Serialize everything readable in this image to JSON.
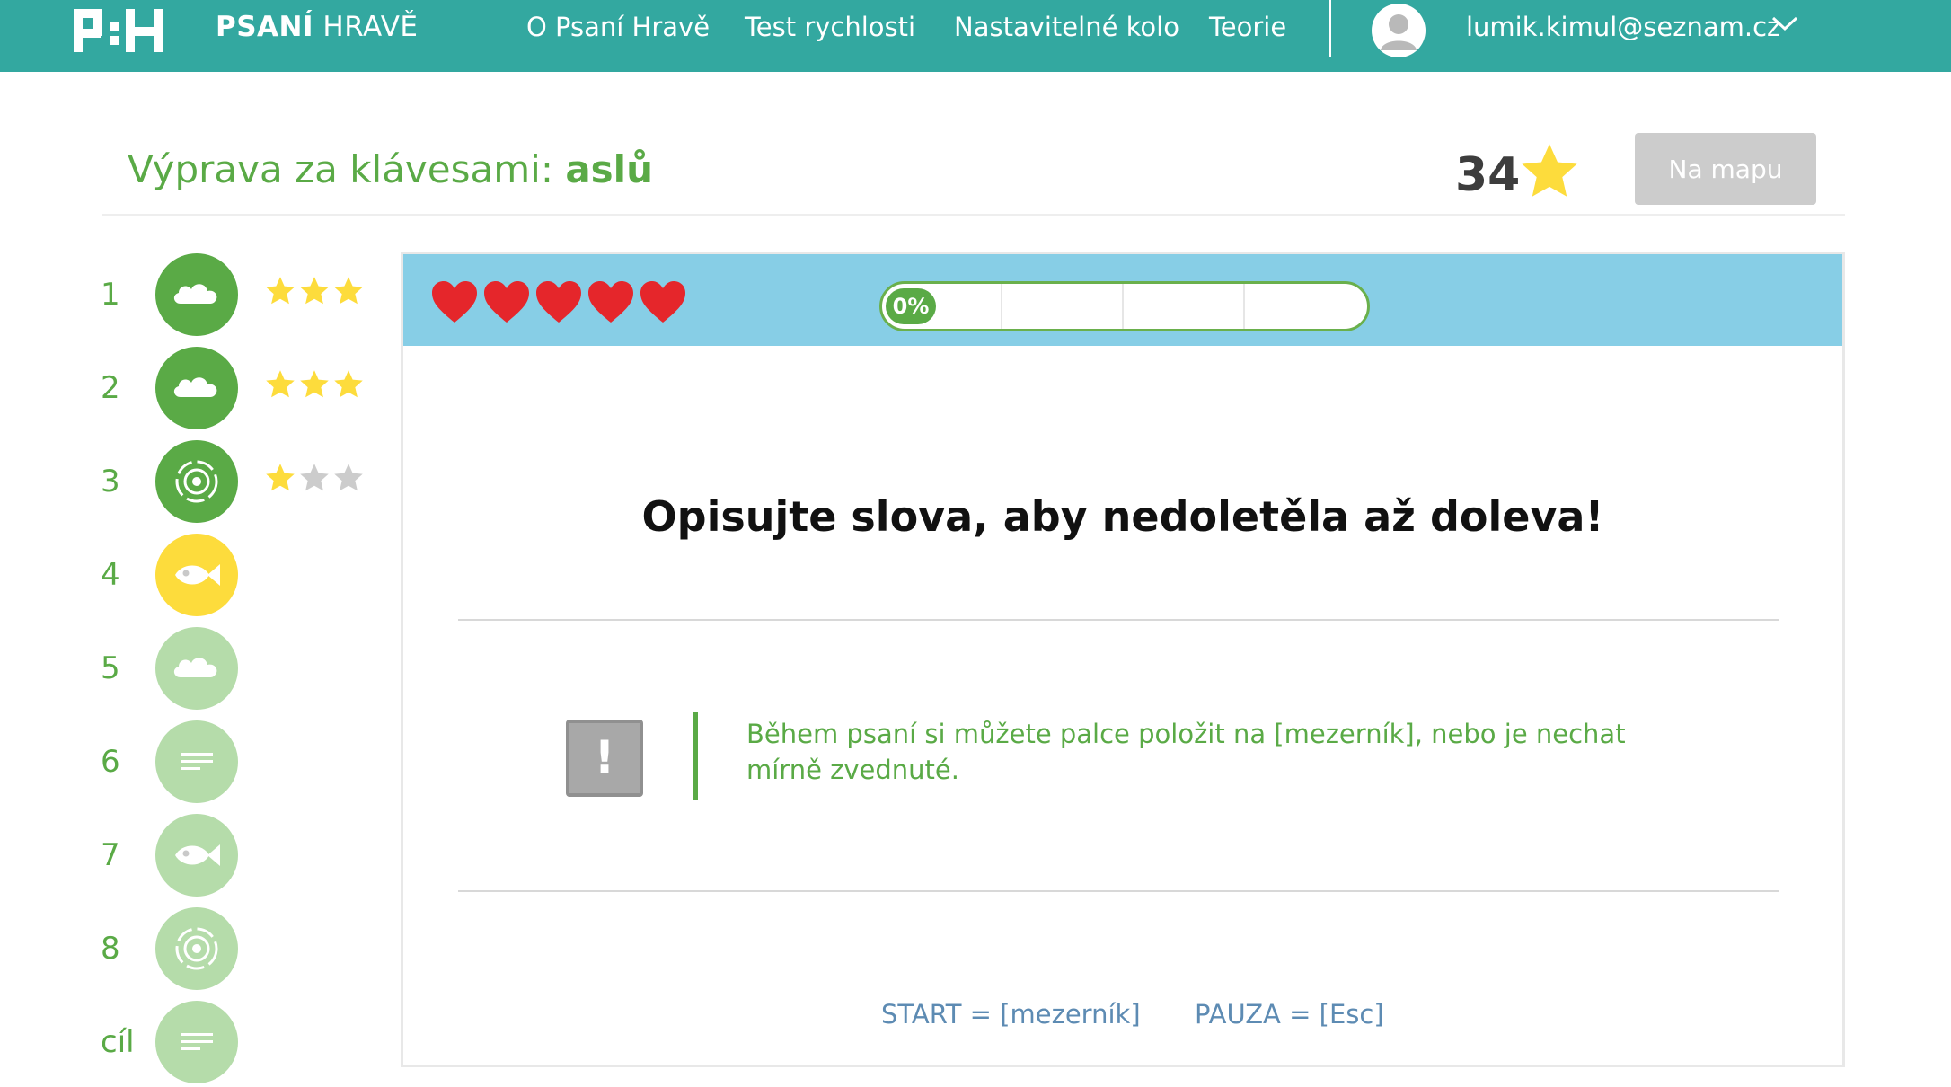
{
  "nav": {
    "brand_bold": "PSANÍ",
    "brand_light": "HRAVĚ",
    "links": [
      {
        "label": "O Psaní Hravě"
      },
      {
        "label": "Test rychlosti"
      },
      {
        "label": "Nastavitelné kolo"
      },
      {
        "label": "Teorie"
      }
    ],
    "user_email": "lumik.kimul@seznam.cz",
    "colors": {
      "bar": "#33a8a0"
    }
  },
  "header": {
    "title_prefix": "Výprava za klávesami:",
    "title_keys": "aslů",
    "stars_count": "34",
    "map_button_label": "Na mapu"
  },
  "levels": [
    {
      "number": "1",
      "icon": "cloud-icon",
      "state": "done",
      "stars": 3
    },
    {
      "number": "2",
      "icon": "cloud-icon",
      "state": "done",
      "stars": 3
    },
    {
      "number": "3",
      "icon": "target-icon",
      "state": "done",
      "stars": 1
    },
    {
      "number": "4",
      "icon": "fish-icon",
      "state": "current",
      "stars": 0
    },
    {
      "number": "5",
      "icon": "cloud-icon",
      "state": "locked",
      "stars": 0
    },
    {
      "number": "6",
      "icon": "text-lines-icon",
      "state": "locked",
      "stars": 0
    },
    {
      "number": "7",
      "icon": "fish-icon",
      "state": "locked",
      "stars": 0
    },
    {
      "number": "8",
      "icon": "target-icon",
      "state": "locked",
      "stars": 0
    },
    {
      "number": "cíl",
      "icon": "text-lines-icon",
      "state": "locked",
      "stars": 0
    }
  ],
  "game": {
    "lives": 5,
    "progress_percent": 0,
    "progress_label": "0%",
    "instruction": "Opisujte slova, aby nedoletěla až doleva!",
    "tip_icon_glyph": "!",
    "tip_text": "Během psaní si můžete palce položit na [mezerník], nebo je nechat mírně zvednuté.",
    "shortcut_start": "START = [mezerník]",
    "shortcut_pause": "PAUZA = [Esc]"
  },
  "colors": {
    "green": "#5aaa46",
    "green_done": "#5aaa46",
    "green_locked": "#b5dcaa",
    "yellow_current": "#fddc3c",
    "star_on": "#fddc3c",
    "star_off": "#cccccc",
    "heart": "#e5262b",
    "panel_bar": "#87cee6"
  }
}
